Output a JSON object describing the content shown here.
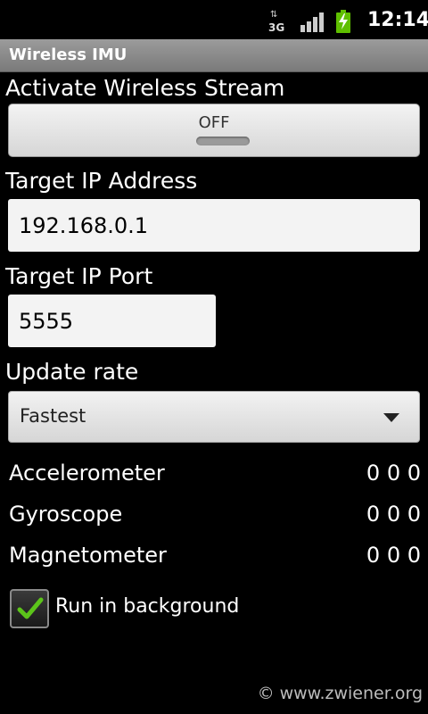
{
  "status_bar": {
    "network_label": "3G",
    "network_icon": "3g-data-icon",
    "signal_icon": "signal-strength-icon",
    "battery_icon": "battery-charging-icon",
    "time": "12:14"
  },
  "app": {
    "title": "Wireless IMU"
  },
  "stream": {
    "label": "Activate Wireless Stream",
    "toggle_text": "OFF",
    "on": false
  },
  "target_ip": {
    "label": "Target IP Address",
    "value": "192.168.0.1"
  },
  "target_port": {
    "label": "Target IP Port",
    "value": "5555"
  },
  "update_rate": {
    "label": "Update rate",
    "selected": "Fastest"
  },
  "sensors": [
    {
      "name": "Accelerometer",
      "values": "0 0 0"
    },
    {
      "name": "Gyroscope",
      "values": "0 0 0"
    },
    {
      "name": "Magnetometer",
      "values": "0 0 0"
    }
  ],
  "background": {
    "label": "Run in background",
    "checked": true
  },
  "footer": {
    "text": "© www.zwiener.org"
  },
  "colors": {
    "accent_check": "#5cc41a",
    "title_bar": "#8a8a8a",
    "battery": "#5fbf00"
  }
}
